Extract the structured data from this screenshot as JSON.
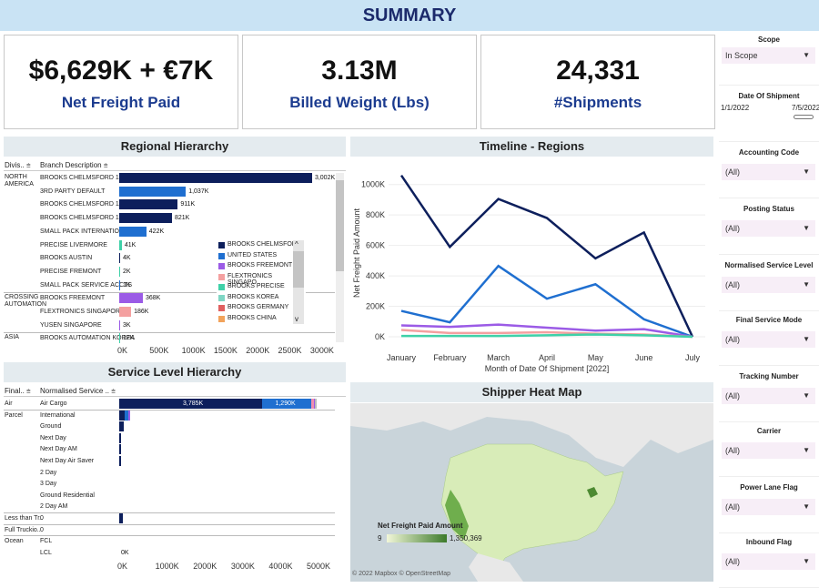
{
  "header": {
    "title": "SUMMARY"
  },
  "kpis": [
    {
      "value": "$6,629K + €7K",
      "label": "Net Freight Paid"
    },
    {
      "value": "3.13M",
      "label": "Billed Weight (Lbs)"
    },
    {
      "value": "24,331",
      "label": "#Shipments"
    }
  ],
  "regional": {
    "title": "Regional Hierarchy",
    "col1": "Divis..",
    "col2": "Branch Description",
    "groups": [
      {
        "name": "NORTH AMERICA",
        "rows": [
          {
            "branch": "BROOKS CHELMSFORD 12",
            "value": 3002,
            "label": "3,002K",
            "color": "#0d1f5c"
          },
          {
            "branch": "3RD PARTY DEFAULT",
            "value": 1037,
            "label": "1,037K",
            "color": "#1f6fd0"
          },
          {
            "branch": "BROOKS CHELMSFORD 11",
            "value": 911,
            "label": "911K",
            "color": "#0d1f5c"
          },
          {
            "branch": "BROOKS CHELMSFORD 15",
            "value": 821,
            "label": "821K",
            "color": "#0d1f5c"
          },
          {
            "branch": "SMALL PACK INTERNATIONAL",
            "value": 422,
            "label": "422K",
            "color": "#1f6fd0"
          },
          {
            "branch": "PRECISE LIVERMORE",
            "value": 41,
            "label": "41K",
            "color": "#3fd1a8"
          },
          {
            "branch": "BROOKS AUSTIN",
            "value": 4,
            "label": "4K",
            "color": "#0d1f5c"
          },
          {
            "branch": "PRECISE FREMONT",
            "value": 2,
            "label": "2K",
            "color": "#3fd1a8"
          },
          {
            "branch": "SMALL PACK SERVICE ACCTS",
            "value": 1,
            "label": "1K",
            "color": "#1f6fd0"
          }
        ]
      },
      {
        "name": "CROSSING AUTOMATION",
        "rows": [
          {
            "branch": "BROOKS FREEMONT",
            "value": 368,
            "label": "368K",
            "color": "#9b5be6"
          },
          {
            "branch": "FLEXTRONICS SINGAPORE",
            "value": 186,
            "label": "186K",
            "color": "#f4a0a0"
          },
          {
            "branch": "YUSEN SINGAPORE",
            "value": 3,
            "label": "3K",
            "color": "#9b5be6"
          }
        ]
      },
      {
        "name": "ASIA",
        "rows": [
          {
            "branch": "BROOKS AUTOMATION KOREA",
            "value": 12,
            "label": "12K",
            "color": "#3fd1a8"
          }
        ]
      }
    ],
    "xticks": [
      "0K",
      "500K",
      "1000K",
      "1500K",
      "2000K",
      "2500K",
      "3000K"
    ],
    "legend": [
      {
        "name": "BROOKS CHELMSFORD",
        "color": "#0d1f5c"
      },
      {
        "name": "UNITED STATES",
        "color": "#1f6fd0"
      },
      {
        "name": "BROOKS FREEMONT",
        "color": "#9b5be6"
      },
      {
        "name": "FLEXTRONICS SINGAPO..",
        "color": "#f4a0a0"
      },
      {
        "name": "BROOKS PRECISE",
        "color": "#3fd1a8"
      },
      {
        "name": "BROOKS KOREA",
        "color": "#7fd6c4"
      },
      {
        "name": "BROOKS GERMANY",
        "color": "#e06060"
      },
      {
        "name": "BROOKS CHINA",
        "color": "#f2a35b"
      }
    ]
  },
  "service": {
    "title": "Service Level Hierarchy",
    "col1": "Final..",
    "col2": "Normalised Service ..",
    "rows": [
      {
        "g": "Air",
        "s": "Air Cargo"
      },
      {
        "g": "Parcel",
        "s": "International"
      },
      {
        "g": "",
        "s": "Ground"
      },
      {
        "g": "",
        "s": "Next Day"
      },
      {
        "g": "",
        "s": "Next Day AM"
      },
      {
        "g": "",
        "s": "Next Day Air Saver"
      },
      {
        "g": "",
        "s": "2 Day"
      },
      {
        "g": "",
        "s": "3 Day"
      },
      {
        "g": "",
        "s": "Ground Residential"
      },
      {
        "g": "",
        "s": "2 Day AM"
      },
      {
        "g": "Less than Tr..",
        "s": "0"
      },
      {
        "g": "Full Truckio..",
        "s": "0"
      },
      {
        "g": "Ocean",
        "s": "FCL"
      },
      {
        "g": "",
        "s": "LCL"
      }
    ],
    "air_labels": [
      "3,785K",
      "1,290K"
    ],
    "lcl_label": "0K",
    "xticks": [
      "0K",
      "1000K",
      "2000K",
      "3000K",
      "4000K",
      "5000K"
    ]
  },
  "timeline": {
    "title": "Timeline - Regions",
    "ylabel": "Net Freight Paid Amount",
    "xlabel": "Month of Date Of Shipment [2022]",
    "yticks": [
      "0K",
      "200K",
      "400K",
      "600K",
      "800K",
      "1000K"
    ]
  },
  "heatmap": {
    "title": "Shipper Heat Map",
    "legend_title": "Net Freight Paid Amount",
    "min": "9",
    "max": "1,350,369",
    "credit": "© 2022 Mapbox © OpenStreetMap"
  },
  "filters": [
    {
      "label": "Scope",
      "value": "In Scope"
    },
    {
      "label": "Date Of Shipment",
      "from": "1/1/2022",
      "to": "7/5/2022"
    },
    {
      "label": "Accounting Code",
      "value": "(All)"
    },
    {
      "label": "Posting Status",
      "value": "(All)"
    },
    {
      "label": "Normalised Service Level",
      "value": "(All)"
    },
    {
      "label": "Final Service Mode",
      "value": "(All)"
    },
    {
      "label": "Tracking Number",
      "value": "(All)"
    },
    {
      "label": "Carrier",
      "value": "(All)"
    },
    {
      "label": "Power Lane Flag",
      "value": "(All)"
    },
    {
      "label": "Inbound Flag",
      "value": "(All)"
    }
  ],
  "chart_data": [
    {
      "type": "bar",
      "title": "Regional Hierarchy",
      "categories": [
        "BROOKS CHELMSFORD 12",
        "3RD PARTY DEFAULT",
        "BROOKS CHELMSFORD 11",
        "BROOKS CHELMSFORD 15",
        "SMALL PACK INTERNATIONAL",
        "PRECISE LIVERMORE",
        "BROOKS AUSTIN",
        "PRECISE FREMONT",
        "SMALL PACK SERVICE ACCTS",
        "BROOKS FREEMONT",
        "FLEXTRONICS SINGAPORE",
        "YUSEN SINGAPORE",
        "BROOKS AUTOMATION KOREA"
      ],
      "values": [
        3002,
        1037,
        911,
        821,
        422,
        41,
        4,
        2,
        1,
        368,
        186,
        3,
        12
      ],
      "xlim": [
        0,
        3300
      ]
    },
    {
      "type": "line",
      "title": "Timeline - Regions",
      "x": [
        "January",
        "February",
        "March",
        "April",
        "May",
        "June",
        "July"
      ],
      "ylabel": "Net Freight Paid Amount",
      "xlabel": "Month of Date Of Shipment [2022]",
      "ylim": [
        0,
        1100
      ],
      "series": [
        {
          "color": "#0d1f5c",
          "values": [
            1060,
            590,
            905,
            780,
            515,
            685,
            0
          ]
        },
        {
          "color": "#1f6fd0",
          "values": [
            170,
            95,
            465,
            250,
            345,
            115,
            0
          ]
        },
        {
          "color": "#9b5be6",
          "values": [
            75,
            65,
            80,
            60,
            40,
            50,
            0
          ]
        },
        {
          "color": "#f4a0a0",
          "values": [
            45,
            25,
            25,
            30,
            20,
            15,
            0
          ]
        },
        {
          "color": "#3fd1a8",
          "values": [
            5,
            5,
            5,
            10,
            15,
            10,
            0
          ]
        }
      ]
    },
    {
      "type": "bar",
      "title": "Service Level Hierarchy",
      "categories": [
        "Air Cargo",
        "International",
        "Ground",
        "Next Day",
        "Next Day AM",
        "Next Day Air Saver",
        "LCL"
      ],
      "values": [
        5300,
        300,
        110,
        40,
        35,
        30,
        0
      ],
      "xlim": [
        0,
        5600
      ]
    }
  ]
}
